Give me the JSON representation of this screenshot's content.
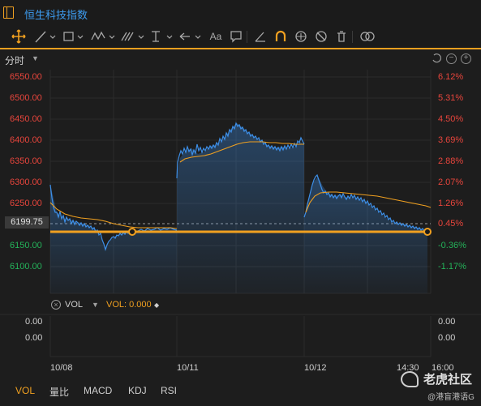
{
  "header": {
    "title": "恒生科技指数"
  },
  "toolbar": {
    "text_tool_label": "Aa"
  },
  "period": {
    "label": "分时"
  },
  "price_axis": [
    "6550.00",
    "6500.00",
    "6450.00",
    "6400.00",
    "6350.00",
    "6300.00",
    "6250.00",
    "6199.75",
    "6150.00",
    "6100.00"
  ],
  "pct_axis": [
    "6.12%",
    "5.31%",
    "4.50%",
    "3.69%",
    "2.88%",
    "2.07%",
    "1.26%",
    "0.45%",
    "-0.36%",
    "-1.17%"
  ],
  "reference_price": "6199.75",
  "x_axis": {
    "d1": "10/08",
    "d2": "10/11",
    "d3": "10/12",
    "t1": "14:30",
    "t2": "16:00"
  },
  "volume": {
    "name": "VOL",
    "value_text": "VOL: 0.000",
    "axis_left": [
      "0.00",
      "0.00"
    ],
    "axis_right": [
      "0.00",
      "0.00"
    ]
  },
  "indicator_tabs": [
    "VOL",
    "量比",
    "MACD",
    "KDJ",
    "RSI"
  ],
  "watermark": {
    "brand": "老虎社区",
    "user": "@港盲港语G"
  },
  "colors": {
    "accent": "#f0a020",
    "price_line": "#3d8fe8",
    "avg_line": "#f0a020",
    "up": "#e8453c",
    "down": "#24b35a"
  },
  "chart_data": {
    "type": "line",
    "x": [
      "10/08",
      "10/11",
      "10/12"
    ],
    "ylim": [
      6100,
      6550
    ],
    "reference": 6199.75,
    "series": [
      {
        "name": "",
        "values": [
          6300,
          6210,
          6185,
          6140,
          6180,
          6190,
          6185,
          6380,
          6400,
          6440,
          6420,
          6395,
          6380,
          6400,
          6310,
          6220,
          6280,
          6240,
          6200,
          6185
        ]
      }
    ]
  }
}
